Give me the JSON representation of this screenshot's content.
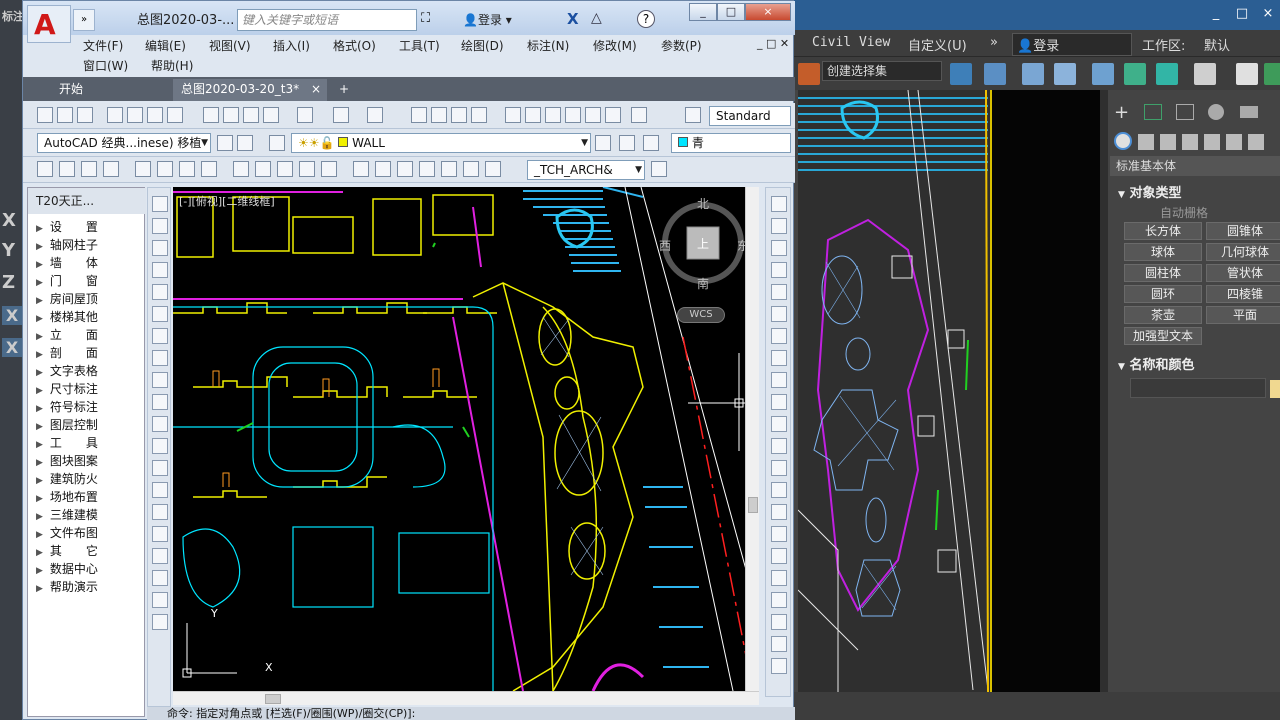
{
  "left_strip": {
    "labels": [
      "标注",
      "X",
      "Y",
      "Z",
      "X",
      "X"
    ]
  },
  "max": {
    "menu": [
      "Civil View",
      "自定义(U)",
      "»",
      "登录",
      "工作区:",
      "默认"
    ],
    "selection_set": "创建选择集",
    "panel": {
      "dropdown": "标准基本体",
      "section_objtype": "对象类型",
      "autogrid": "自动栅格",
      "buttons": [
        "长方体",
        "圆锥体",
        "球体",
        "几何球体",
        "圆柱体",
        "管状体",
        "圆环",
        "四棱锥",
        "茶壶",
        "平面",
        "加强型文本"
      ],
      "section_name": "名称和颜色"
    },
    "colors": {
      "titlebar": "#2b5e93",
      "accent": "#d9c100"
    }
  },
  "cad": {
    "qa_label": "»",
    "title": "总图2020-03-...",
    "search_placeholder": "键入关键字或短语",
    "login": "登录",
    "win_buttons": [
      "_",
      "□",
      "×"
    ],
    "menu_row1": [
      "文件(F)",
      "编辑(E)",
      "视图(V)",
      "插入(I)",
      "格式(O)",
      "工具(T)",
      "绘图(D)",
      "标注(N)",
      "修改(M)",
      "参数(P)"
    ],
    "menu_row2": [
      "窗口(W)",
      "帮助(H)"
    ],
    "tabs": [
      "开始",
      "总图2020-03-20_t3*"
    ],
    "tab_close": "×",
    "tab_add": "+",
    "style_combo": "Standard",
    "workspace_combo": "AutoCAD 经典...inese) 移植",
    "layer_combo": "WALL",
    "color_combo": "青",
    "linetype_combo": "_TCH_ARCH&",
    "palette": {
      "title": "T20天正...",
      "items": [
        "设　　置",
        "轴网柱子",
        "墙　　体",
        "门　　窗",
        "房间屋顶",
        "楼梯其他",
        "立　　面",
        "剖　　面",
        "文字表格",
        "尺寸标注",
        "符号标注",
        "图层控制",
        "工　　具",
        "图块图案",
        "建筑防火",
        "场地布置",
        "三维建模",
        "文件布图",
        "其　　它",
        "数据中心",
        "帮助演示"
      ]
    },
    "viewport_label": "[-][俯视][二维线框]",
    "viewcube": {
      "north": "北",
      "south": "南",
      "east": "东",
      "west": "西",
      "top": "上",
      "wcs": "WCS"
    },
    "ucs": {
      "y": "Y",
      "x": "X"
    },
    "command": "命令: 指定对角点或 [栏选(F)/圈围(WP)/圈交(CP)]:",
    "colors": {
      "cyan": "#00e5ff",
      "yellow": "#f0f000",
      "magenta": "#e020e0",
      "green": "#20d020",
      "red": "#ff2020",
      "orange": "#ff9a20"
    }
  }
}
